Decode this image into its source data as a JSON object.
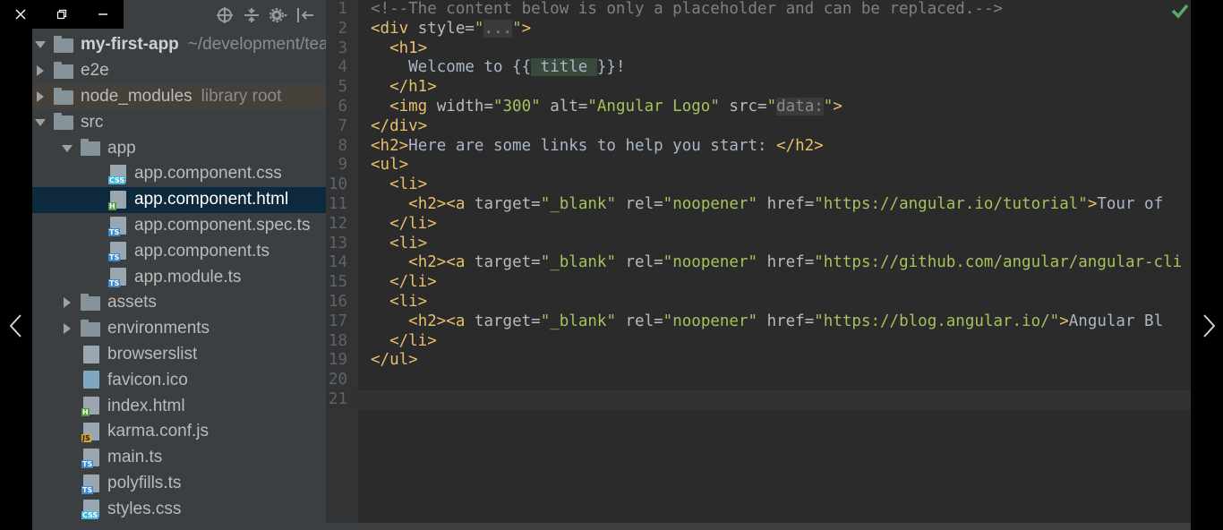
{
  "sidebar": {
    "toolbar_icons": [
      "target-icon",
      "collapse-icon",
      "gear-icon",
      "hide-icon"
    ],
    "tree": [
      {
        "label": "my-first-app",
        "hint": "~/development/tea",
        "type": "root-folder",
        "depth": 0,
        "arrow": "expanded"
      },
      {
        "label": "e2e",
        "hint": "",
        "type": "folder",
        "depth": 0,
        "arrow": "collapsed"
      },
      {
        "label": "node_modules",
        "hint": "library root",
        "type": "folder",
        "depth": 0,
        "arrow": "collapsed"
      },
      {
        "label": "src",
        "hint": "",
        "type": "folder",
        "depth": 0,
        "arrow": "expanded"
      },
      {
        "label": "app",
        "hint": "",
        "type": "folder",
        "depth": 1,
        "arrow": "expanded"
      },
      {
        "label": "app.component.css",
        "hint": "",
        "type": "file",
        "badge": "CSS",
        "depth": 2
      },
      {
        "label": "app.component.html",
        "hint": "",
        "type": "file",
        "badge": "H",
        "depth": 2
      },
      {
        "label": "app.component.spec.ts",
        "hint": "",
        "type": "file",
        "badge": "TS",
        "depth": 2
      },
      {
        "label": "app.component.ts",
        "hint": "",
        "type": "file",
        "badge": "TS",
        "depth": 2
      },
      {
        "label": "app.module.ts",
        "hint": "",
        "type": "file",
        "badge": "TS",
        "depth": 2
      },
      {
        "label": "assets",
        "hint": "",
        "type": "folder",
        "depth": 1,
        "arrow": "collapsed"
      },
      {
        "label": "environments",
        "hint": "",
        "type": "folder",
        "depth": 1,
        "arrow": "collapsed"
      },
      {
        "label": "browserslist",
        "hint": "",
        "type": "file",
        "badge": "",
        "depth": 1
      },
      {
        "label": "favicon.ico",
        "hint": "",
        "type": "file",
        "badge": "IMG",
        "depth": 1
      },
      {
        "label": "index.html",
        "hint": "",
        "type": "file",
        "badge": "H",
        "depth": 1
      },
      {
        "label": "karma.conf.js",
        "hint": "",
        "type": "file",
        "badge": "JS",
        "depth": 1
      },
      {
        "label": "main.ts",
        "hint": "",
        "type": "file",
        "badge": "TS",
        "depth": 1
      },
      {
        "label": "polyfills.ts",
        "hint": "",
        "type": "file",
        "badge": "TS",
        "depth": 1
      },
      {
        "label": "styles.css",
        "hint": "",
        "type": "file",
        "badge": "CSS",
        "depth": 1
      }
    ],
    "selected_label": "app.component.html",
    "library_root_label": "node_modules"
  },
  "editor": {
    "file": "app.component.html",
    "status": "check-icon",
    "lines": [
      [
        [
          "cmt",
          "<!--The content below is only a placeholder and can be replaced.-->"
        ]
      ],
      [
        [
          "tag",
          "<div "
        ],
        [
          "attr",
          "style="
        ],
        [
          "str",
          "\""
        ],
        [
          "fold",
          "..."
        ],
        [
          "str",
          "\""
        ],
        [
          "tag",
          ">"
        ]
      ],
      [
        [
          "plain",
          "  "
        ],
        [
          "tag",
          "<h1>"
        ]
      ],
      [
        [
          "plain",
          "    Welcome to {{"
        ],
        [
          "interp",
          " title "
        ],
        [
          "plain",
          "}}!"
        ]
      ],
      [
        [
          "plain",
          "  "
        ],
        [
          "tag",
          "</h1>"
        ]
      ],
      [
        [
          "plain",
          "  "
        ],
        [
          "tag",
          "<img "
        ],
        [
          "attr",
          "width="
        ],
        [
          "str",
          "\"300\" "
        ],
        [
          "attr",
          "alt="
        ],
        [
          "str",
          "\"Angular Logo\" "
        ],
        [
          "attr",
          "src="
        ],
        [
          "str",
          "\""
        ],
        [
          "fold",
          "data:"
        ],
        [
          "str",
          "\""
        ],
        [
          "tag",
          ">"
        ]
      ],
      [
        [
          "tag",
          "</div>"
        ]
      ],
      [
        [
          "tag",
          "<h2>"
        ],
        [
          "plain",
          "Here are some links to help you start: "
        ],
        [
          "tag",
          "</h2>"
        ]
      ],
      [
        [
          "tag",
          "<ul>"
        ]
      ],
      [
        [
          "plain",
          "  "
        ],
        [
          "tag",
          "<li>"
        ]
      ],
      [
        [
          "plain",
          "    "
        ],
        [
          "tag",
          "<h2><a "
        ],
        [
          "attr",
          "target="
        ],
        [
          "str",
          "\"_blank\" "
        ],
        [
          "attr",
          "rel="
        ],
        [
          "str",
          "\"noopener\" "
        ],
        [
          "attr",
          "href="
        ],
        [
          "str",
          "\"https://angular.io/tutorial\""
        ],
        [
          "tag",
          ">"
        ],
        [
          "plain",
          "Tour of"
        ]
      ],
      [
        [
          "plain",
          "  "
        ],
        [
          "tag",
          "</li>"
        ]
      ],
      [
        [
          "plain",
          "  "
        ],
        [
          "tag",
          "<li>"
        ]
      ],
      [
        [
          "plain",
          "    "
        ],
        [
          "tag",
          "<h2><a "
        ],
        [
          "attr",
          "target="
        ],
        [
          "str",
          "\"_blank\" "
        ],
        [
          "attr",
          "rel="
        ],
        [
          "str",
          "\"noopener\" "
        ],
        [
          "attr",
          "href="
        ],
        [
          "str",
          "\"https://github.com/angular/angular-cli"
        ]
      ],
      [
        [
          "plain",
          "  "
        ],
        [
          "tag",
          "</li>"
        ]
      ],
      [
        [
          "plain",
          "  "
        ],
        [
          "tag",
          "<li>"
        ]
      ],
      [
        [
          "plain",
          "    "
        ],
        [
          "tag",
          "<h2><a "
        ],
        [
          "attr",
          "target="
        ],
        [
          "str",
          "\"_blank\" "
        ],
        [
          "attr",
          "rel="
        ],
        [
          "str",
          "\"noopener\" "
        ],
        [
          "attr",
          "href="
        ],
        [
          "str",
          "\"https://blog.angular.io/\""
        ],
        [
          "tag",
          ">"
        ],
        [
          "plain",
          "Angular Bl"
        ]
      ],
      [
        [
          "plain",
          "  "
        ],
        [
          "tag",
          "</li>"
        ]
      ],
      [
        [
          "tag",
          "</ul>"
        ]
      ],
      [
        [
          "plain",
          ""
        ]
      ],
      [
        [
          "plain",
          ""
        ]
      ]
    ],
    "current_line": 21
  },
  "window": {
    "controls": [
      "close-icon",
      "restore-icon",
      "minimize-icon"
    ],
    "nav": [
      "previous-arrow-icon",
      "next-arrow-icon"
    ]
  },
  "colors": {
    "sidebar_bg": "#3c3f41",
    "editor_bg": "#2b2b2b",
    "selection_bg": "#0d293e",
    "tag": "#e8bf6a",
    "string": "#a5c25c",
    "comment": "#808080",
    "check": "#59a869"
  }
}
